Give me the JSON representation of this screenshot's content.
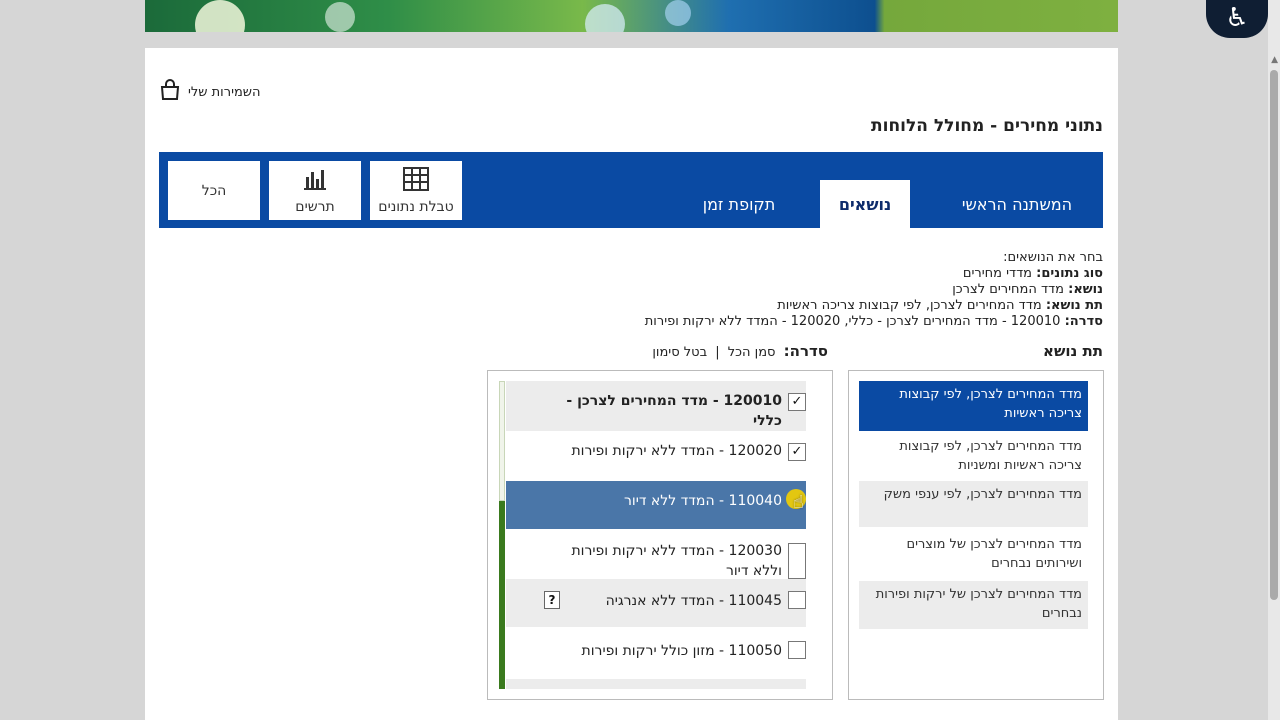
{
  "header": {
    "saved_label": "השמירות שלי",
    "page_title": "נתוני מחירים - מחולל הלוחות"
  },
  "tabs": [
    {
      "label": "המשתנה הראשי",
      "active": false
    },
    {
      "label": "נושאים",
      "active": true
    },
    {
      "label": "תקופת זמן",
      "active": false
    }
  ],
  "toolbar": {
    "table_label": "טבלת נתונים",
    "chart_label": "תרשים",
    "all_label": "הכל"
  },
  "summary": {
    "intro": "בחר את הנושאים:",
    "data_type_label": "סוג נתונים:",
    "data_type_value": "מדדי מחירים",
    "topic_label": "נושא:",
    "topic_value": "מדד המחירים לצרכן",
    "subtopic_label": "תת נושא:",
    "subtopic_value": "מדד המחירים לצרכן, לפי קבוצות צריכה ראשיות",
    "series_label": "סדרה:",
    "series_value": "120010 - מדד המחירים לצרכן - כללי, 120020 - המדד ללא ירקות ופירות"
  },
  "subtopic": {
    "title": "תת נושא",
    "items": [
      {
        "label": "מדד המחירים לצרכן, לפי קבוצות צריכה ראשיות",
        "state": "selected"
      },
      {
        "label": "מדד המחירים לצרכן, לפי קבוצות צריכה ראשיות ומשניות",
        "state": "normal"
      },
      {
        "label": "מדד המחירים לצרכן, לפי ענפי משק",
        "state": "shade"
      },
      {
        "label": "מדד המחירים לצרכן של מוצרים ושירותים נבחרים",
        "state": "normal"
      },
      {
        "label": "מדד המחירים לצרכן של ירקות ופירות נבחרים",
        "state": "shade"
      }
    ]
  },
  "series": {
    "label": "סדרה:",
    "select_all": "סמן הכל",
    "divider": "|",
    "clear": "בטל סימון",
    "items": [
      {
        "label": "120010 - מדד המחירים לצרכן - כללי",
        "checked": true,
        "bold": true
      },
      {
        "label": "120020 - המדד ללא ירקות ופירות",
        "checked": true,
        "bold": false
      },
      {
        "label": "110040 - המדד ללא דיור",
        "checked": false,
        "highlighted": true
      },
      {
        "label": "120030 - המדד ללא ירקות ופירות וללא דיור",
        "checked": false
      },
      {
        "label": "110045 - המדד ללא אנרגיה",
        "checked": false,
        "help": "?"
      },
      {
        "label": "110050 - מזון כולל ירקות ופירות",
        "checked": false
      }
    ]
  },
  "check_mark": "✓",
  "colors": {
    "brand_blue": "#0a4aa3",
    "highlight_row": "#4a76a8",
    "scroll_green": "#3a7a1e"
  }
}
